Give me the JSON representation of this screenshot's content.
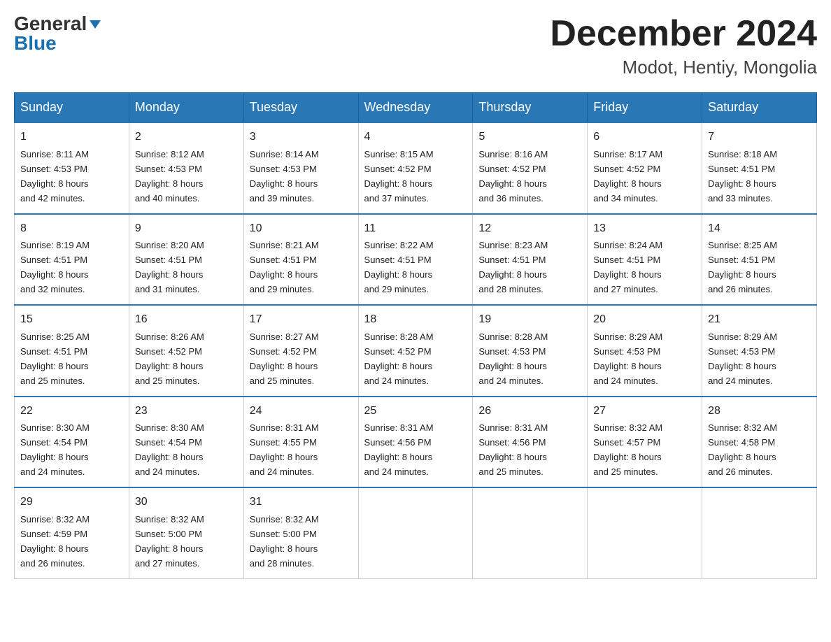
{
  "header": {
    "logo_general": "General",
    "logo_blue": "Blue",
    "month_title": "December 2024",
    "location": "Modot, Hentiy, Mongolia"
  },
  "days_of_week": [
    "Sunday",
    "Monday",
    "Tuesday",
    "Wednesday",
    "Thursday",
    "Friday",
    "Saturday"
  ],
  "weeks": [
    [
      {
        "day": "1",
        "sunrise": "8:11 AM",
        "sunset": "4:53 PM",
        "daylight": "8 hours and 42 minutes."
      },
      {
        "day": "2",
        "sunrise": "8:12 AM",
        "sunset": "4:53 PM",
        "daylight": "8 hours and 40 minutes."
      },
      {
        "day": "3",
        "sunrise": "8:14 AM",
        "sunset": "4:53 PM",
        "daylight": "8 hours and 39 minutes."
      },
      {
        "day": "4",
        "sunrise": "8:15 AM",
        "sunset": "4:52 PM",
        "daylight": "8 hours and 37 minutes."
      },
      {
        "day": "5",
        "sunrise": "8:16 AM",
        "sunset": "4:52 PM",
        "daylight": "8 hours and 36 minutes."
      },
      {
        "day": "6",
        "sunrise": "8:17 AM",
        "sunset": "4:52 PM",
        "daylight": "8 hours and 34 minutes."
      },
      {
        "day": "7",
        "sunrise": "8:18 AM",
        "sunset": "4:51 PM",
        "daylight": "8 hours and 33 minutes."
      }
    ],
    [
      {
        "day": "8",
        "sunrise": "8:19 AM",
        "sunset": "4:51 PM",
        "daylight": "8 hours and 32 minutes."
      },
      {
        "day": "9",
        "sunrise": "8:20 AM",
        "sunset": "4:51 PM",
        "daylight": "8 hours and 31 minutes."
      },
      {
        "day": "10",
        "sunrise": "8:21 AM",
        "sunset": "4:51 PM",
        "daylight": "8 hours and 29 minutes."
      },
      {
        "day": "11",
        "sunrise": "8:22 AM",
        "sunset": "4:51 PM",
        "daylight": "8 hours and 29 minutes."
      },
      {
        "day": "12",
        "sunrise": "8:23 AM",
        "sunset": "4:51 PM",
        "daylight": "8 hours and 28 minutes."
      },
      {
        "day": "13",
        "sunrise": "8:24 AM",
        "sunset": "4:51 PM",
        "daylight": "8 hours and 27 minutes."
      },
      {
        "day": "14",
        "sunrise": "8:25 AM",
        "sunset": "4:51 PM",
        "daylight": "8 hours and 26 minutes."
      }
    ],
    [
      {
        "day": "15",
        "sunrise": "8:25 AM",
        "sunset": "4:51 PM",
        "daylight": "8 hours and 25 minutes."
      },
      {
        "day": "16",
        "sunrise": "8:26 AM",
        "sunset": "4:52 PM",
        "daylight": "8 hours and 25 minutes."
      },
      {
        "day": "17",
        "sunrise": "8:27 AM",
        "sunset": "4:52 PM",
        "daylight": "8 hours and 25 minutes."
      },
      {
        "day": "18",
        "sunrise": "8:28 AM",
        "sunset": "4:52 PM",
        "daylight": "8 hours and 24 minutes."
      },
      {
        "day": "19",
        "sunrise": "8:28 AM",
        "sunset": "4:53 PM",
        "daylight": "8 hours and 24 minutes."
      },
      {
        "day": "20",
        "sunrise": "8:29 AM",
        "sunset": "4:53 PM",
        "daylight": "8 hours and 24 minutes."
      },
      {
        "day": "21",
        "sunrise": "8:29 AM",
        "sunset": "4:53 PM",
        "daylight": "8 hours and 24 minutes."
      }
    ],
    [
      {
        "day": "22",
        "sunrise": "8:30 AM",
        "sunset": "4:54 PM",
        "daylight": "8 hours and 24 minutes."
      },
      {
        "day": "23",
        "sunrise": "8:30 AM",
        "sunset": "4:54 PM",
        "daylight": "8 hours and 24 minutes."
      },
      {
        "day": "24",
        "sunrise": "8:31 AM",
        "sunset": "4:55 PM",
        "daylight": "8 hours and 24 minutes."
      },
      {
        "day": "25",
        "sunrise": "8:31 AM",
        "sunset": "4:56 PM",
        "daylight": "8 hours and 24 minutes."
      },
      {
        "day": "26",
        "sunrise": "8:31 AM",
        "sunset": "4:56 PM",
        "daylight": "8 hours and 25 minutes."
      },
      {
        "day": "27",
        "sunrise": "8:32 AM",
        "sunset": "4:57 PM",
        "daylight": "8 hours and 25 minutes."
      },
      {
        "day": "28",
        "sunrise": "8:32 AM",
        "sunset": "4:58 PM",
        "daylight": "8 hours and 26 minutes."
      }
    ],
    [
      {
        "day": "29",
        "sunrise": "8:32 AM",
        "sunset": "4:59 PM",
        "daylight": "8 hours and 26 minutes."
      },
      {
        "day": "30",
        "sunrise": "8:32 AM",
        "sunset": "5:00 PM",
        "daylight": "8 hours and 27 minutes."
      },
      {
        "day": "31",
        "sunrise": "8:32 AM",
        "sunset": "5:00 PM",
        "daylight": "8 hours and 28 minutes."
      },
      null,
      null,
      null,
      null
    ]
  ],
  "labels": {
    "sunrise": "Sunrise:",
    "sunset": "Sunset:",
    "daylight": "Daylight:"
  }
}
